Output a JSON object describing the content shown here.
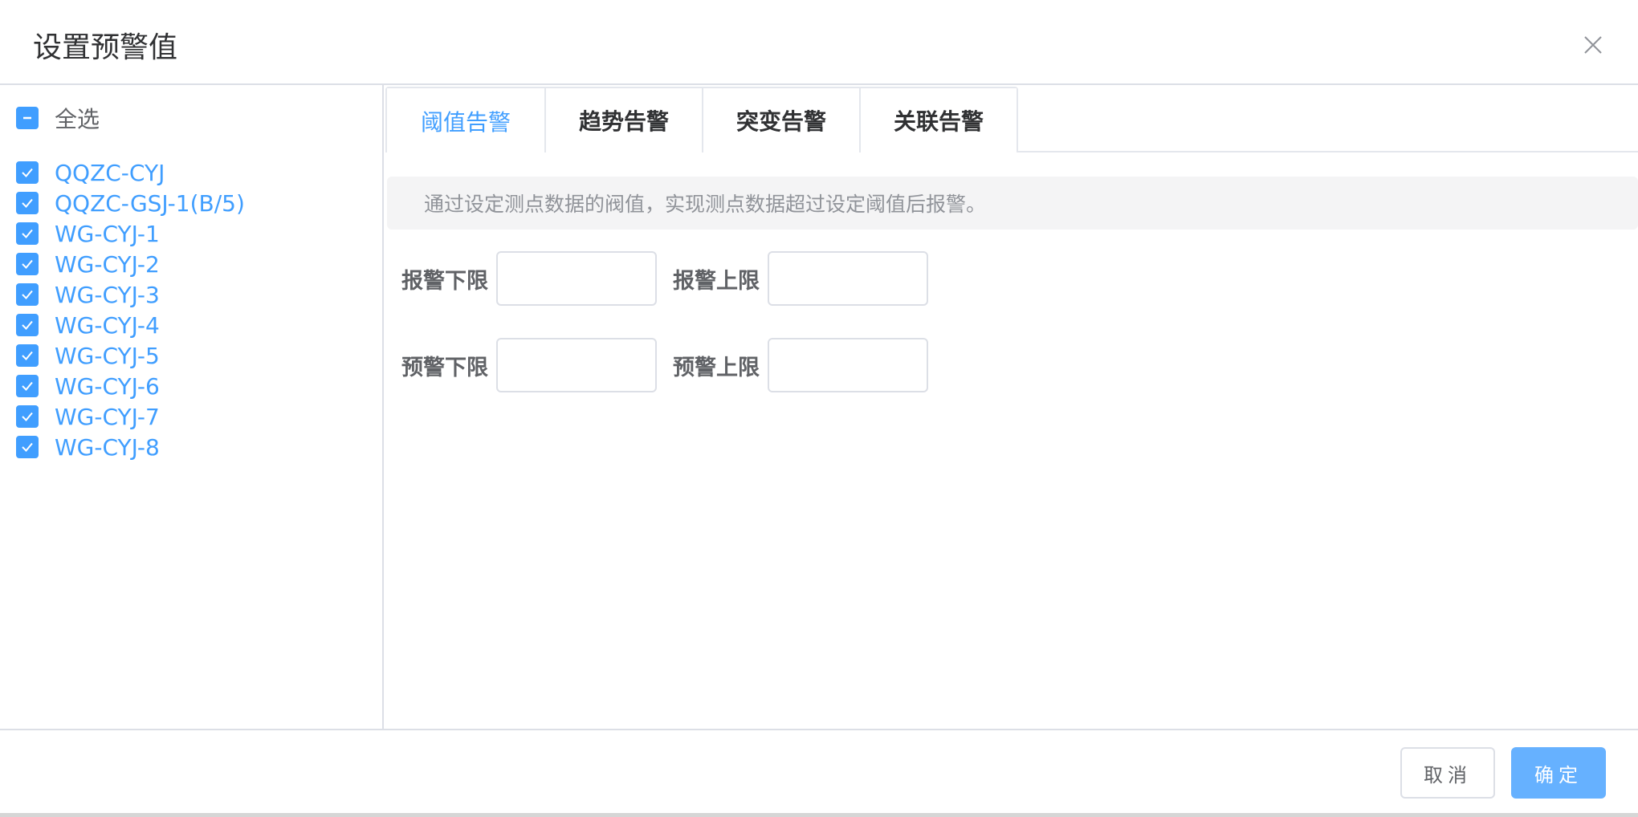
{
  "dialog": {
    "title": "设置预警值",
    "close_icon": "close-icon"
  },
  "left_panel": {
    "select_all_label": "全选",
    "select_all_state": "indeterminate",
    "items": [
      {
        "label": "QQZC-CYJ",
        "checked": true
      },
      {
        "label": "QQZC-GSJ-1(B/5)",
        "checked": true
      },
      {
        "label": "WG-CYJ-1",
        "checked": true
      },
      {
        "label": "WG-CYJ-2",
        "checked": true
      },
      {
        "label": "WG-CYJ-3",
        "checked": true
      },
      {
        "label": "WG-CYJ-4",
        "checked": true
      },
      {
        "label": "WG-CYJ-5",
        "checked": true
      },
      {
        "label": "WG-CYJ-6",
        "checked": true
      },
      {
        "label": "WG-CYJ-7",
        "checked": true
      },
      {
        "label": "WG-CYJ-8",
        "checked": true
      }
    ]
  },
  "tabs": [
    {
      "label": "阈值告警",
      "active": true
    },
    {
      "label": "趋势告警",
      "active": false
    },
    {
      "label": "突变告警",
      "active": false
    },
    {
      "label": "关联告警",
      "active": false
    }
  ],
  "alert_text": "通过设定测点数据的阀值，实现测点数据超过设定阈值后报警。",
  "form": {
    "alarm_lower_label": "报警下限",
    "alarm_lower_value": "",
    "alarm_upper_label": "报警上限",
    "alarm_upper_value": "",
    "warn_lower_label": "预警下限",
    "warn_lower_value": "",
    "warn_upper_label": "预警上限",
    "warn_upper_value": ""
  },
  "footer": {
    "cancel_label": "取消",
    "confirm_label": "确定"
  },
  "colors": {
    "primary": "#409eff",
    "primary_light": "#66b1ff",
    "border": "#dcdfe6",
    "alert_bg": "#f4f4f5"
  }
}
